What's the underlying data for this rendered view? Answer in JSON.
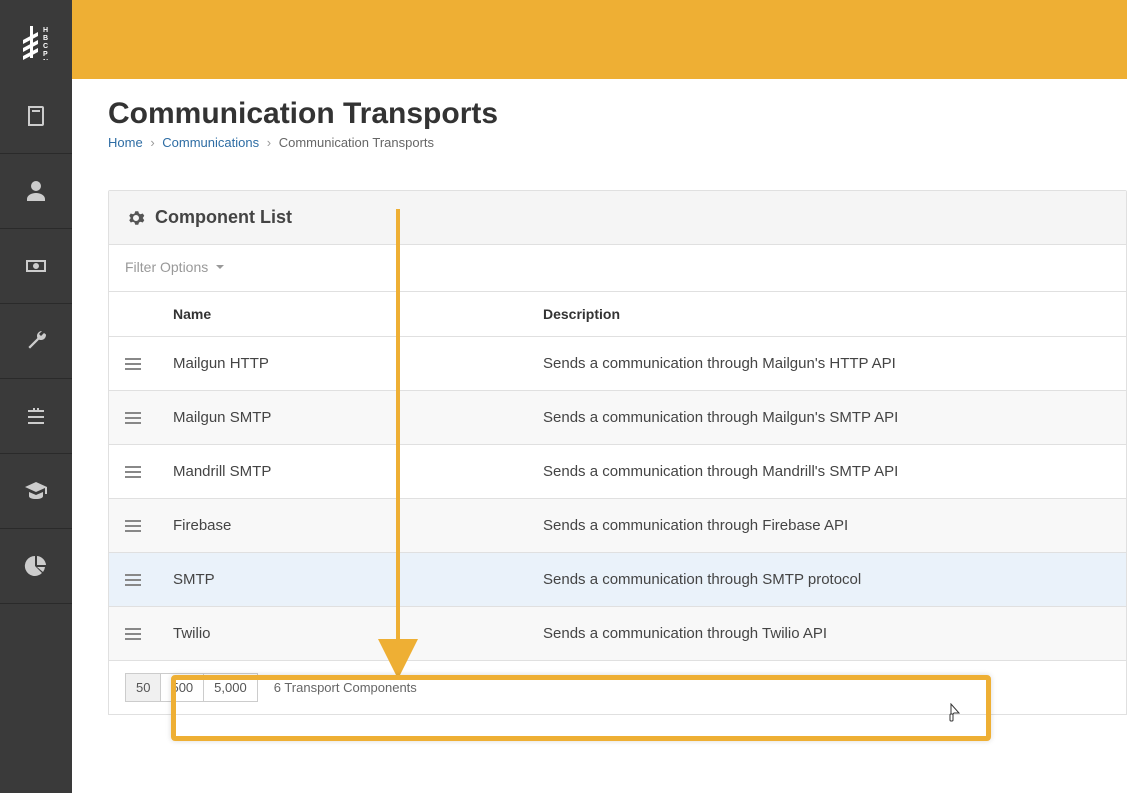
{
  "page": {
    "title": "Communication Transports"
  },
  "breadcrumb": {
    "home": "Home",
    "section": "Communications",
    "current": "Communication Transports"
  },
  "panel": {
    "title": "Component List",
    "filter_label": "Filter Options"
  },
  "table": {
    "headers": {
      "name": "Name",
      "description": "Description"
    },
    "rows": [
      {
        "name": "Mailgun HTTP",
        "description": "Sends a communication through Mailgun's HTTP API",
        "highlighted": false
      },
      {
        "name": "Mailgun SMTP",
        "description": "Sends a communication through Mailgun's SMTP API",
        "highlighted": false
      },
      {
        "name": "Mandrill SMTP",
        "description": "Sends a communication through Mandrill's SMTP API",
        "highlighted": false
      },
      {
        "name": "Firebase",
        "description": "Sends a communication through Firebase API",
        "highlighted": false
      },
      {
        "name": "SMTP",
        "description": "Sends a communication through SMTP protocol",
        "highlighted": true
      },
      {
        "name": "Twilio",
        "description": "Sends a communication through Twilio API",
        "highlighted": false
      }
    ]
  },
  "footer": {
    "page_sizes": [
      "50",
      "500",
      "5,000"
    ],
    "active_size": "50",
    "count_label": "6 Transport Components"
  },
  "colors": {
    "accent": "#eeaf34",
    "sidebar": "#3a3a3a",
    "link": "#2e6da4"
  }
}
